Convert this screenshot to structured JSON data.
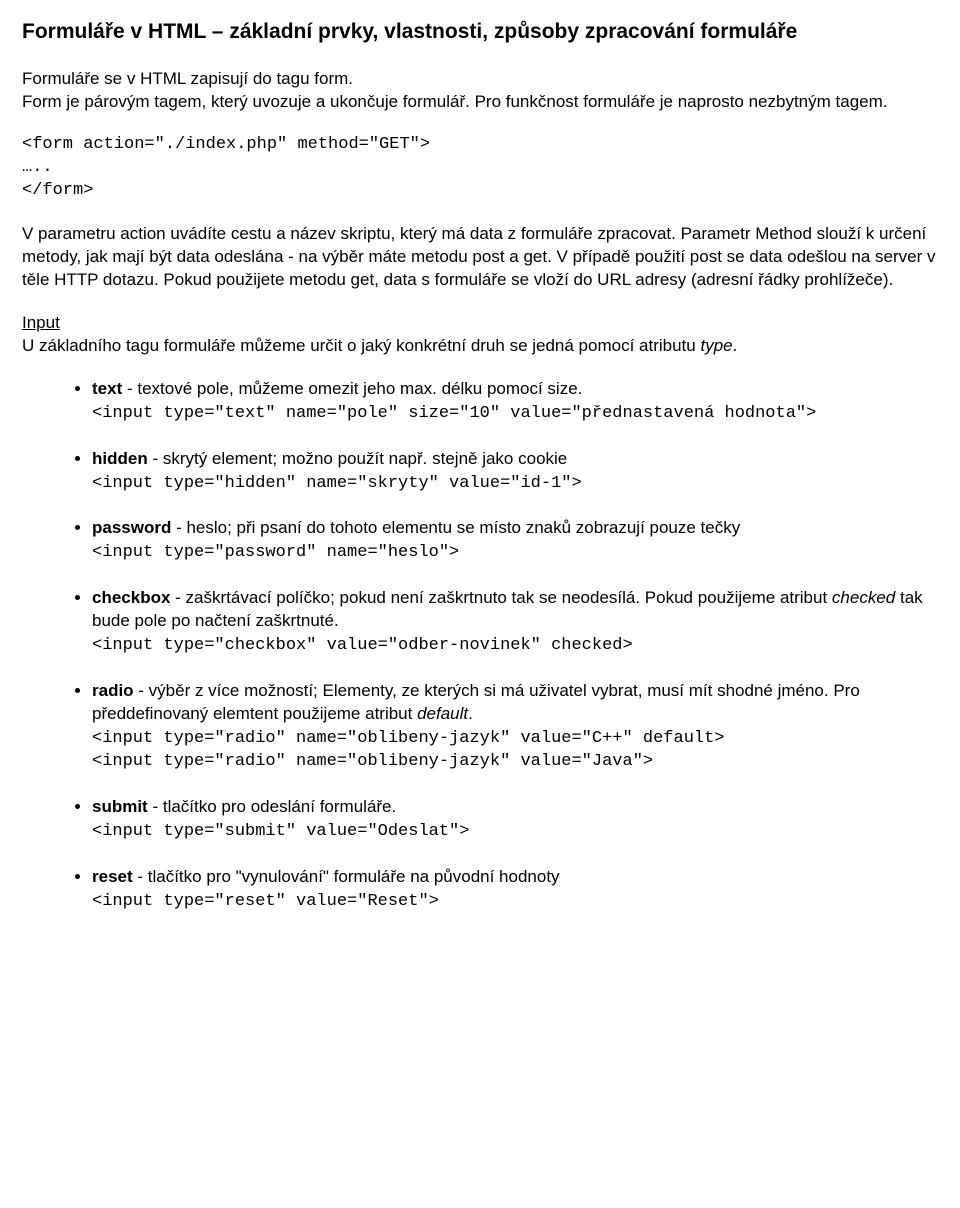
{
  "title": "Formuláře v HTML – základní prvky, vlastnosti, způsoby zpracování formuláře",
  "intro": "Formuláře se v HTML zapisují do tagu form.\nForm je párovým tagem, který uvozuje a ukončuje formulář. Pro funkčnost formuláře je naprosto nezbytným tagem.",
  "codeblock1": "<form action=\"./index.php\" method=\"GET\">\n…..\n</form>",
  "para_action": "V parametru action uvádíte cestu a název skriptu, který má data z formuláře zpracovat. Parametr Method slouží k určení metody, jak mají být data odeslána - na výběr máte metodu post a get. V případě použití post se data odešlou na server v těle HTTP dotazu. Pokud použijete metodu get, data s formuláře se vloží do URL adresy (adresní řádky prohlížeče).",
  "input_heading": "Input",
  "input_intro_a": "U základního tagu formuláře můžeme určit o jaký konkrétní druh se jedná pomocí atributu ",
  "input_intro_type": "type",
  "items": {
    "text": {
      "name": "text",
      "desc": " - textové pole, můžeme omezit jeho max. délku pomocí size.",
      "code": "<input type=\"text\" name=\"pole\" size=\"10\" value=\"přednastavená hodnota\">"
    },
    "hidden": {
      "name": "hidden",
      "desc": " - skrytý element; možno použít např. stejně jako cookie",
      "code": "<input type=\"hidden\" name=\"skryty\" value=\"id-1\">"
    },
    "password": {
      "name": "password",
      "desc": " - heslo; při psaní do tohoto elementu se místo znaků zobrazují pouze tečky",
      "code": "<input type=\"password\" name=\"heslo\">"
    },
    "checkbox": {
      "name": "checkbox",
      "desc_a": " - zaškrtávací políčko; pokud není zaškrtnuto tak se neodesílá. Pokud použijeme atribut ",
      "checked": "checked",
      "desc_b": " tak bude pole po načtení zaškrtnuté.",
      "code": "<input type=\"checkbox\" value=\"odber-novinek\" checked>"
    },
    "radio": {
      "name": "radio",
      "desc_a": " - výběr z více možností; Elementy, ze kterých si má uživatel vybrat, musí mít shodné jméno. Pro předdefinovaný elemtent použijeme atribut ",
      "default": "default",
      "desc_b": ".",
      "code": "<input type=\"radio\" name=\"oblibeny-jazyk\" value=\"C++\" default>\n<input type=\"radio\" name=\"oblibeny-jazyk\" value=\"Java\">"
    },
    "submit": {
      "name": "submit",
      "desc": " - tlačítko pro odeslání formuláře.",
      "code": "<input type=\"submit\" value=\"Odeslat\">"
    },
    "reset": {
      "name": "reset",
      "desc": " - tlačítko pro \"vynulování\" formuláře na původní hodnoty",
      "code": "<input type=\"reset\" value=\"Reset\">"
    }
  }
}
